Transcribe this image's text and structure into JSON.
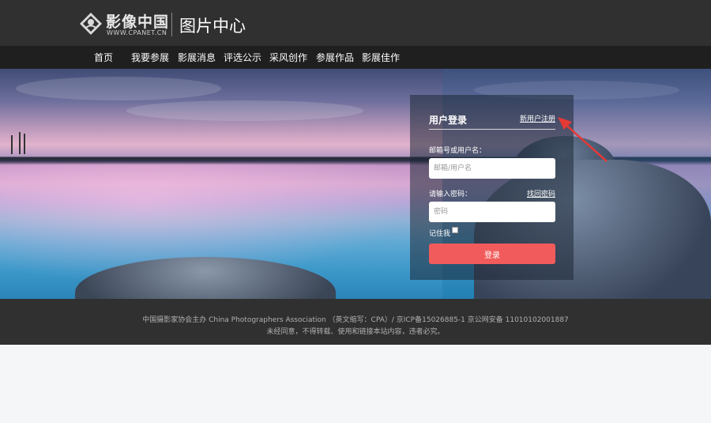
{
  "header": {
    "logo_cn": "影像中国",
    "logo_en": "WWW.CPANET.CN",
    "site_title": "图片中心"
  },
  "nav": {
    "items": [
      "首页",
      "我要参展",
      "影展消息",
      "评选公示",
      "采风创作",
      "参展作品",
      "影展佳作"
    ]
  },
  "login": {
    "title": "用户登录",
    "register_link": "新用户注册",
    "email_label": "邮箱号或用户名：",
    "email_placeholder": "邮箱/用户名",
    "password_label": "请输入密码：",
    "forgot_link": "找回密码",
    "password_placeholder": "密码",
    "remember_label": "记住我",
    "remember_checked": false,
    "submit_label": "登录"
  },
  "footer": {
    "line1": "中国摄影家协会主办 China Photographers Association （英文缩写：CPA）/ 京ICP备15026885-1 京公网安备 11010102001887",
    "line2": "未经同意，不得转载、使用和链接本站内容，违者必究。"
  },
  "colors": {
    "header_bg": "#303030",
    "nav_bg": "#1f1f1f",
    "login_button": "#f25b5b",
    "annotation_arrow": "#e53935"
  },
  "icons": {
    "logo": "cpa-emblem-icon",
    "annotation": "red-arrow-icon"
  }
}
